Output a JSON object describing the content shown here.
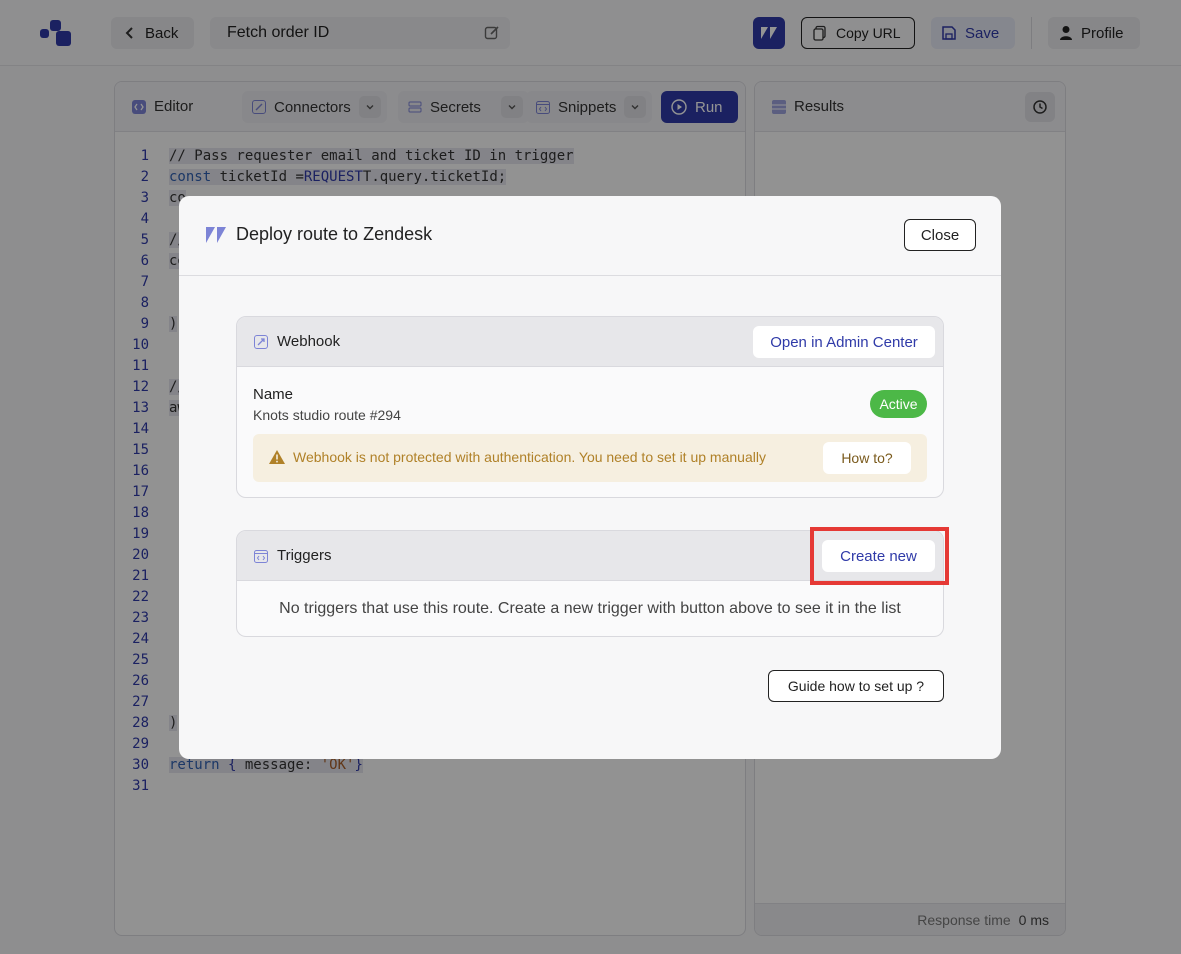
{
  "topbar": {
    "back_label": "Back",
    "route_title": "Fetch order ID",
    "copy_url_label": "Copy URL",
    "save_label": "Save",
    "profile_label": "Profile"
  },
  "editor": {
    "title": "Editor",
    "connectors_label": "Connectors",
    "secrets_label": "Secrets",
    "snippets_label": "Snippets",
    "run_label": "Run",
    "code_lines": [
      {
        "n": "1",
        "text": "// Pass requester email and ticket ID in trigger"
      },
      {
        "n": "2",
        "text": "const ticketId = REQUEST.query.ticketId;"
      },
      {
        "n": "3",
        "text": "co"
      },
      {
        "n": "4",
        "text": ""
      },
      {
        "n": "5",
        "text": "//"
      },
      {
        "n": "6",
        "text": "co"
      },
      {
        "n": "7",
        "text": ""
      },
      {
        "n": "8",
        "text": ""
      },
      {
        "n": "9",
        "text": ")"
      },
      {
        "n": "10",
        "text": ""
      },
      {
        "n": "11",
        "text": ""
      },
      {
        "n": "12",
        "text": "//"
      },
      {
        "n": "13",
        "text": "aw"
      },
      {
        "n": "14",
        "text": ""
      },
      {
        "n": "15",
        "text": ""
      },
      {
        "n": "16",
        "text": ""
      },
      {
        "n": "17",
        "text": ""
      },
      {
        "n": "18",
        "text": ""
      },
      {
        "n": "19",
        "text": ""
      },
      {
        "n": "20",
        "text": ""
      },
      {
        "n": "21",
        "text": ""
      },
      {
        "n": "22",
        "text": ""
      },
      {
        "n": "23",
        "text": ""
      },
      {
        "n": "24",
        "text": ""
      },
      {
        "n": "25",
        "text": ""
      },
      {
        "n": "26",
        "text": ""
      },
      {
        "n": "27",
        "text": ""
      },
      {
        "n": "28",
        "text": ")"
      },
      {
        "n": "29",
        "text": ""
      },
      {
        "n": "30",
        "text": "return { message: 'OK'}"
      },
      {
        "n": "31",
        "text": ""
      }
    ]
  },
  "results": {
    "title": "Results",
    "response_time_label": "Response time",
    "response_time_value": "0 ms"
  },
  "modal": {
    "title": "Deploy route to Zendesk",
    "close_label": "Close",
    "webhook": {
      "heading": "Webhook",
      "open_admin_label": "Open in Admin Center",
      "name_label": "Name",
      "name_value": "Knots studio route #294",
      "status": "Active",
      "warning": "Webhook is not protected with authentication. You need to set it up manually",
      "howto_label": "How to?"
    },
    "triggers": {
      "heading": "Triggers",
      "create_label": "Create new",
      "empty_text": "No triggers that use this route. Create a new trigger with button above to see it in the list"
    },
    "guide_label": "Guide how to set up ?"
  },
  "colors": {
    "accent": "#2f3aa8",
    "active": "#4cb847",
    "warning_text": "#b08128",
    "highlight": "#e53935"
  },
  "icons": [
    "logo-icon",
    "chevron-left-icon",
    "edit-icon",
    "zendesk-icon",
    "copy-icon",
    "save-icon",
    "user-icon",
    "code-icon",
    "connector-icon",
    "secret-icon",
    "snippet-icon",
    "chevron-down-icon",
    "play-icon",
    "table-icon",
    "history-icon",
    "webhook-icon",
    "warning-icon",
    "trigger-icon"
  ]
}
